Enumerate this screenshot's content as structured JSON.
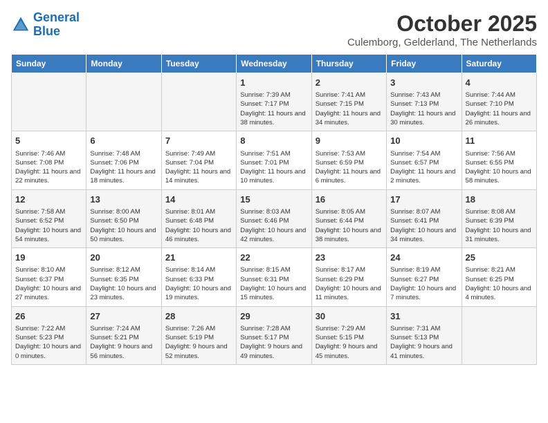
{
  "header": {
    "logo_line1": "General",
    "logo_line2": "Blue",
    "month": "October 2025",
    "location": "Culemborg, Gelderland, The Netherlands"
  },
  "days_of_week": [
    "Sunday",
    "Monday",
    "Tuesday",
    "Wednesday",
    "Thursday",
    "Friday",
    "Saturday"
  ],
  "weeks": [
    [
      {
        "day": "",
        "sunrise": "",
        "sunset": "",
        "daylight": ""
      },
      {
        "day": "",
        "sunrise": "",
        "sunset": "",
        "daylight": ""
      },
      {
        "day": "",
        "sunrise": "",
        "sunset": "",
        "daylight": ""
      },
      {
        "day": "1",
        "sunrise": "Sunrise: 7:39 AM",
        "sunset": "Sunset: 7:17 PM",
        "daylight": "Daylight: 11 hours and 38 minutes."
      },
      {
        "day": "2",
        "sunrise": "Sunrise: 7:41 AM",
        "sunset": "Sunset: 7:15 PM",
        "daylight": "Daylight: 11 hours and 34 minutes."
      },
      {
        "day": "3",
        "sunrise": "Sunrise: 7:43 AM",
        "sunset": "Sunset: 7:13 PM",
        "daylight": "Daylight: 11 hours and 30 minutes."
      },
      {
        "day": "4",
        "sunrise": "Sunrise: 7:44 AM",
        "sunset": "Sunset: 7:10 PM",
        "daylight": "Daylight: 11 hours and 26 minutes."
      }
    ],
    [
      {
        "day": "5",
        "sunrise": "Sunrise: 7:46 AM",
        "sunset": "Sunset: 7:08 PM",
        "daylight": "Daylight: 11 hours and 22 minutes."
      },
      {
        "day": "6",
        "sunrise": "Sunrise: 7:48 AM",
        "sunset": "Sunset: 7:06 PM",
        "daylight": "Daylight: 11 hours and 18 minutes."
      },
      {
        "day": "7",
        "sunrise": "Sunrise: 7:49 AM",
        "sunset": "Sunset: 7:04 PM",
        "daylight": "Daylight: 11 hours and 14 minutes."
      },
      {
        "day": "8",
        "sunrise": "Sunrise: 7:51 AM",
        "sunset": "Sunset: 7:01 PM",
        "daylight": "Daylight: 11 hours and 10 minutes."
      },
      {
        "day": "9",
        "sunrise": "Sunrise: 7:53 AM",
        "sunset": "Sunset: 6:59 PM",
        "daylight": "Daylight: 11 hours and 6 minutes."
      },
      {
        "day": "10",
        "sunrise": "Sunrise: 7:54 AM",
        "sunset": "Sunset: 6:57 PM",
        "daylight": "Daylight: 11 hours and 2 minutes."
      },
      {
        "day": "11",
        "sunrise": "Sunrise: 7:56 AM",
        "sunset": "Sunset: 6:55 PM",
        "daylight": "Daylight: 10 hours and 58 minutes."
      }
    ],
    [
      {
        "day": "12",
        "sunrise": "Sunrise: 7:58 AM",
        "sunset": "Sunset: 6:52 PM",
        "daylight": "Daylight: 10 hours and 54 minutes."
      },
      {
        "day": "13",
        "sunrise": "Sunrise: 8:00 AM",
        "sunset": "Sunset: 6:50 PM",
        "daylight": "Daylight: 10 hours and 50 minutes."
      },
      {
        "day": "14",
        "sunrise": "Sunrise: 8:01 AM",
        "sunset": "Sunset: 6:48 PM",
        "daylight": "Daylight: 10 hours and 46 minutes."
      },
      {
        "day": "15",
        "sunrise": "Sunrise: 8:03 AM",
        "sunset": "Sunset: 6:46 PM",
        "daylight": "Daylight: 10 hours and 42 minutes."
      },
      {
        "day": "16",
        "sunrise": "Sunrise: 8:05 AM",
        "sunset": "Sunset: 6:44 PM",
        "daylight": "Daylight: 10 hours and 38 minutes."
      },
      {
        "day": "17",
        "sunrise": "Sunrise: 8:07 AM",
        "sunset": "Sunset: 6:41 PM",
        "daylight": "Daylight: 10 hours and 34 minutes."
      },
      {
        "day": "18",
        "sunrise": "Sunrise: 8:08 AM",
        "sunset": "Sunset: 6:39 PM",
        "daylight": "Daylight: 10 hours and 31 minutes."
      }
    ],
    [
      {
        "day": "19",
        "sunrise": "Sunrise: 8:10 AM",
        "sunset": "Sunset: 6:37 PM",
        "daylight": "Daylight: 10 hours and 27 minutes."
      },
      {
        "day": "20",
        "sunrise": "Sunrise: 8:12 AM",
        "sunset": "Sunset: 6:35 PM",
        "daylight": "Daylight: 10 hours and 23 minutes."
      },
      {
        "day": "21",
        "sunrise": "Sunrise: 8:14 AM",
        "sunset": "Sunset: 6:33 PM",
        "daylight": "Daylight: 10 hours and 19 minutes."
      },
      {
        "day": "22",
        "sunrise": "Sunrise: 8:15 AM",
        "sunset": "Sunset: 6:31 PM",
        "daylight": "Daylight: 10 hours and 15 minutes."
      },
      {
        "day": "23",
        "sunrise": "Sunrise: 8:17 AM",
        "sunset": "Sunset: 6:29 PM",
        "daylight": "Daylight: 10 hours and 11 minutes."
      },
      {
        "day": "24",
        "sunrise": "Sunrise: 8:19 AM",
        "sunset": "Sunset: 6:27 PM",
        "daylight": "Daylight: 10 hours and 7 minutes."
      },
      {
        "day": "25",
        "sunrise": "Sunrise: 8:21 AM",
        "sunset": "Sunset: 6:25 PM",
        "daylight": "Daylight: 10 hours and 4 minutes."
      }
    ],
    [
      {
        "day": "26",
        "sunrise": "Sunrise: 7:22 AM",
        "sunset": "Sunset: 5:23 PM",
        "daylight": "Daylight: 10 hours and 0 minutes."
      },
      {
        "day": "27",
        "sunrise": "Sunrise: 7:24 AM",
        "sunset": "Sunset: 5:21 PM",
        "daylight": "Daylight: 9 hours and 56 minutes."
      },
      {
        "day": "28",
        "sunrise": "Sunrise: 7:26 AM",
        "sunset": "Sunset: 5:19 PM",
        "daylight": "Daylight: 9 hours and 52 minutes."
      },
      {
        "day": "29",
        "sunrise": "Sunrise: 7:28 AM",
        "sunset": "Sunset: 5:17 PM",
        "daylight": "Daylight: 9 hours and 49 minutes."
      },
      {
        "day": "30",
        "sunrise": "Sunrise: 7:29 AM",
        "sunset": "Sunset: 5:15 PM",
        "daylight": "Daylight: 9 hours and 45 minutes."
      },
      {
        "day": "31",
        "sunrise": "Sunrise: 7:31 AM",
        "sunset": "Sunset: 5:13 PM",
        "daylight": "Daylight: 9 hours and 41 minutes."
      },
      {
        "day": "",
        "sunrise": "",
        "sunset": "",
        "daylight": ""
      }
    ]
  ]
}
